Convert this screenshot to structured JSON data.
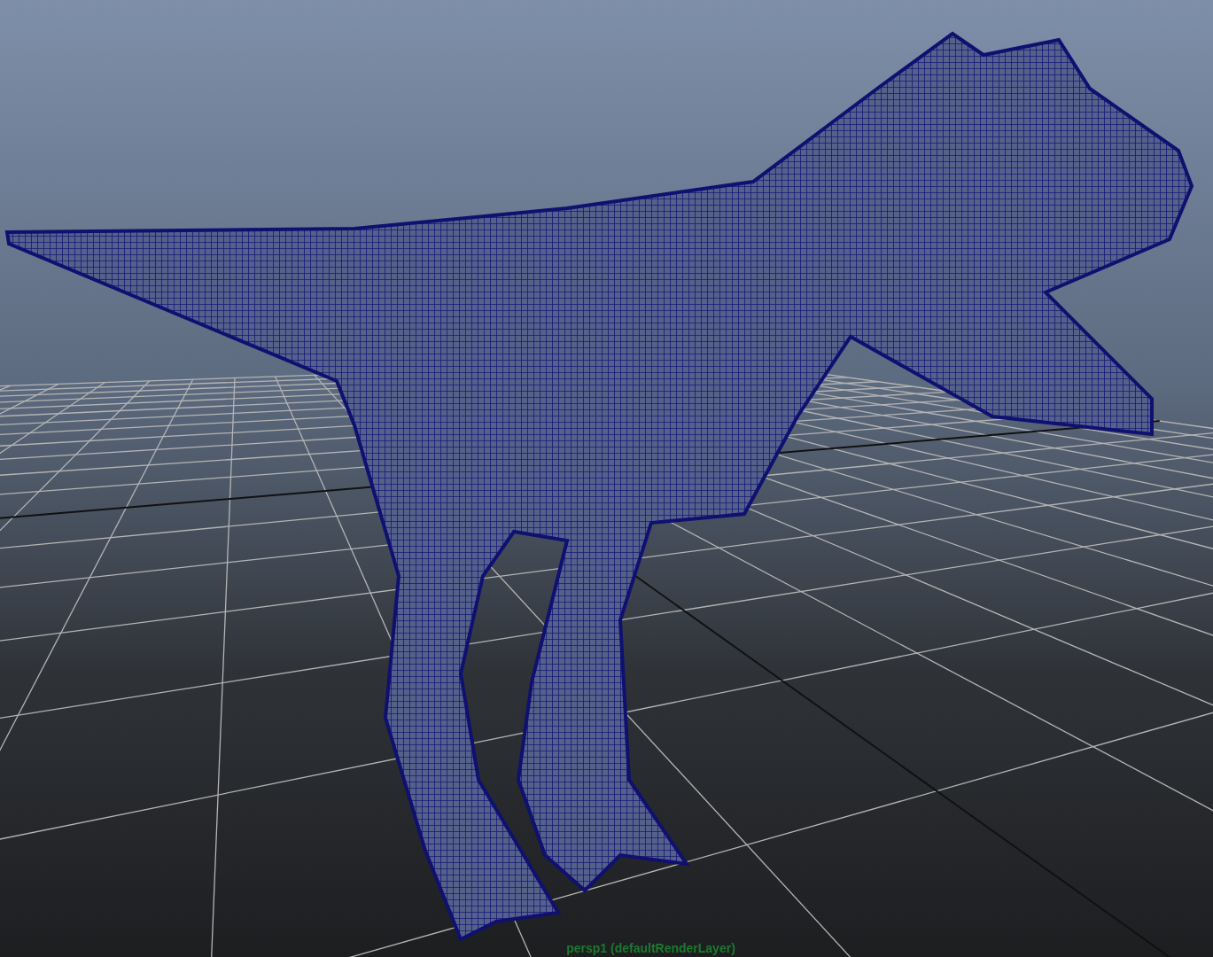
{
  "viewport": {
    "camera_label": "persp1 (defaultRenderLayer)"
  }
}
